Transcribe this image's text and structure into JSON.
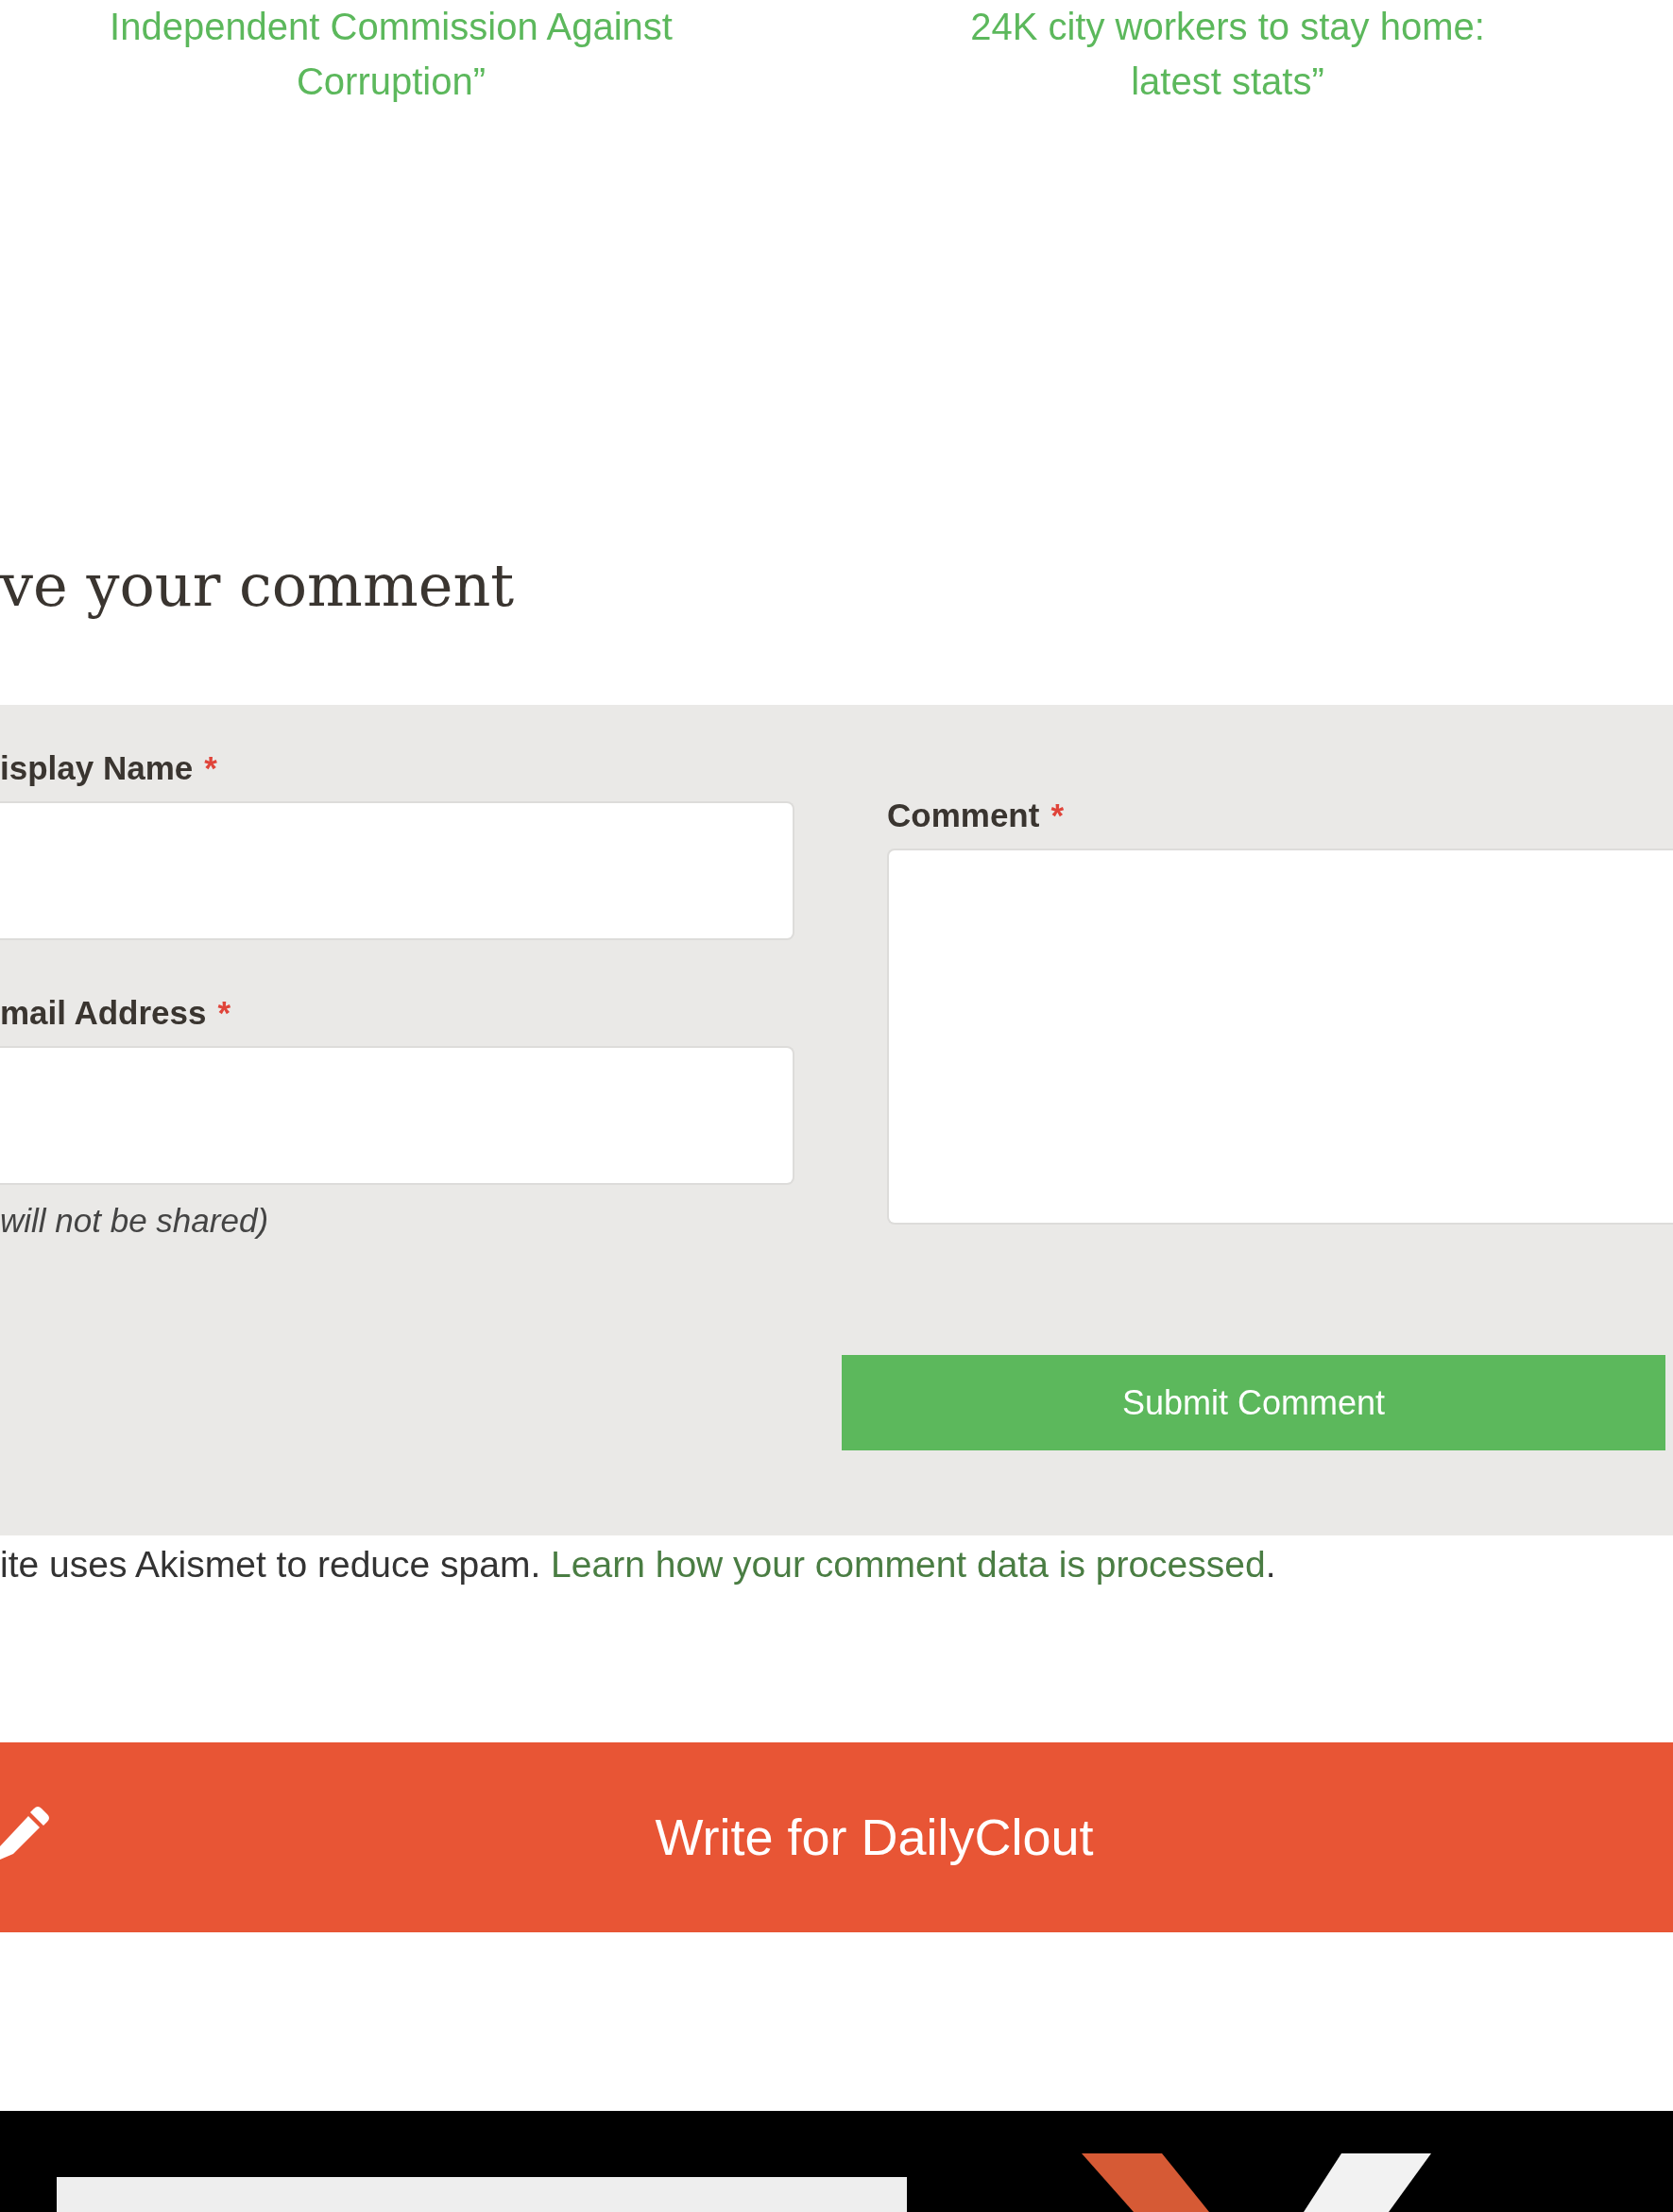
{
  "related_posts": [
    {
      "title": "Independent Commission Against Corruption”"
    },
    {
      "title": "24K city workers to stay home: latest stats”"
    }
  ],
  "comment_form": {
    "heading": "ve your comment",
    "fields": [
      {
        "label": "isplay Name",
        "required_mark": "*",
        "kind": "input"
      },
      {
        "label": "mail Address",
        "required_mark": "*",
        "kind": "input",
        "note": "will not be shared)"
      }
    ],
    "comment": {
      "label": "Comment",
      "required_mark": "*"
    },
    "submit": "Submit Comment"
  },
  "spam_notice": {
    "text": "ite uses Akismet to reduce spam.",
    "link": "Learn how your comment data is processed",
    "end": "."
  },
  "write_banner": {
    "label": "Write for DailyClout"
  }
}
